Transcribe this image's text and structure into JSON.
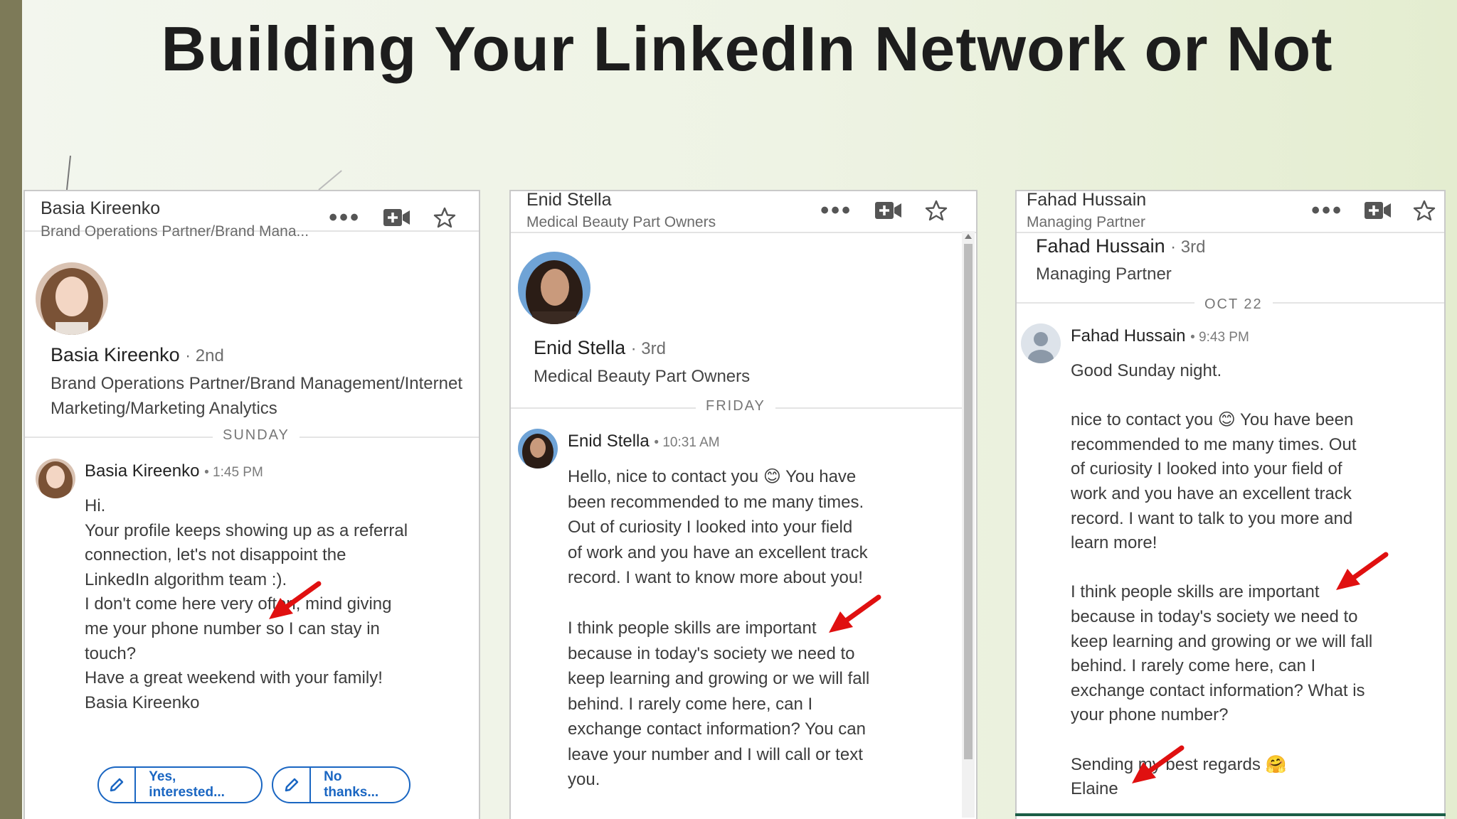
{
  "slide": {
    "title": "Building Your LinkedIn Network or Not",
    "colors": {
      "accent_bar": "#7d7a58",
      "linkedin_blue": "#1a66c2",
      "arrow": "#e01010"
    }
  },
  "panels": [
    {
      "header": {
        "name": "Basia Kireenko",
        "subtitle": "Brand Operations Partner/Brand Mana..."
      },
      "profile": {
        "name": "Basia Kireenko",
        "degree": "· 2nd",
        "headline_line1": "Brand Operations Partner/Brand Management/Internet",
        "headline_line2": "Marketing/Marketing Analytics"
      },
      "day_label": "SUNDAY",
      "message": {
        "sender": "Basia Kireenko",
        "time": "• 1:45 PM",
        "body": "Hi.\nYour profile keeps showing up as a referral\nconnection, let's not disappoint the\nLinkedIn algorithm team :).\nI don't come here very often, mind giving\nme your phone number so I can stay in\ntouch?\nHave a great weekend with your family!\nBasia Kireenko"
      },
      "quick_replies": [
        "Yes, interested...",
        "No thanks..."
      ],
      "icons": [
        "more-dots-icon",
        "video-call-icon",
        "star-icon",
        "pencil-icon"
      ]
    },
    {
      "header": {
        "name": "Enid Stella",
        "subtitle": "Medical Beauty Part Owners"
      },
      "profile": {
        "name": "Enid Stella",
        "degree": "· 3rd",
        "headline_line1": "Medical Beauty Part Owners"
      },
      "day_label": "FRIDAY",
      "message": {
        "sender": "Enid Stella",
        "time": "• 10:31 AM",
        "body": "Hello, nice to contact you 😊 You have\nbeen recommended to me many times.\nOut of curiosity I looked into your field\nof work and you have an excellent track\nrecord. I want to know more about you!\n\nI think people skills are important\nbecause in today's society we need to\nkeep learning and growing or we will fall\nbehind. I rarely come here, can I\nexchange contact information? You can\nleave your number and I will call or text\nyou."
      }
    },
    {
      "header": {
        "name": "Fahad Hussain",
        "subtitle": "Managing Partner"
      },
      "profile": {
        "name": "Fahad Hussain",
        "degree": "· 3rd",
        "headline_line1": "Managing Partner"
      },
      "day_label": "OCT 22",
      "message": {
        "sender": "Fahad Hussain",
        "time": "• 9:43 PM",
        "body": "Good Sunday night.\n\nnice to contact you 😊 You have been\nrecommended to me many times. Out\nof curiosity I looked into your field of\nwork and you have an excellent track\nrecord. I want to talk to you more and\nlearn more!\n\nI think people skills are important\nbecause in today's society we need to\nkeep learning and growing or we will fall\nbehind. I rarely come here, can I\nexchange contact information? What is\nyour phone number?\n\nSending my best regards 🤗\nElaine"
      }
    }
  ]
}
